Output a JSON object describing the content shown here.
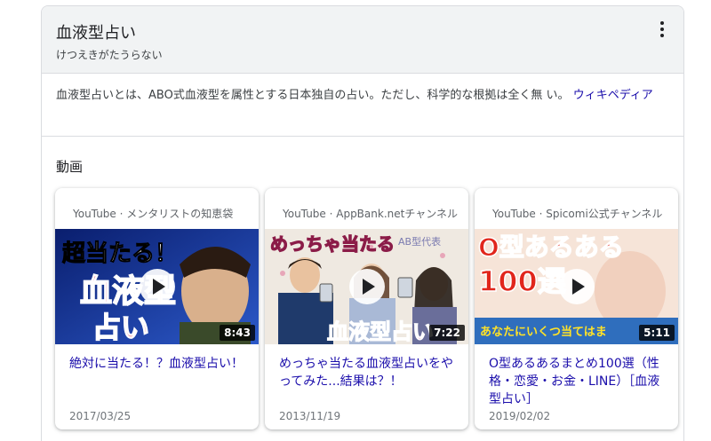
{
  "panel": {
    "title": "血液型占い",
    "subtitle": "けつえきがたうらない",
    "description": "血液型占いとは、ABO式血液型を属性とする日本独自の占い。ただし、科学的な根拠は全く無 い。",
    "description_link": "ウィキペディア",
    "menu_icon": "more-vert-icon"
  },
  "videos": {
    "section_title": "動画",
    "items": [
      {
        "source": "YouTube · メンタリストの知恵袋",
        "thumb_text_1": "超当たる！",
        "thumb_text_2": "血液型",
        "thumb_text_3": "占い",
        "duration": "8:43",
        "title": "絶対に当たる！？血液型占い！",
        "date": "2017/03/25"
      },
      {
        "source": "YouTube · AppBank.netチャンネル",
        "thumb_text_1": "めっちゃ当たる",
        "thumb_text_2": "AB型代表",
        "thumb_text_3": "血液型占い",
        "duration": "7:22",
        "title": "めっちゃ当たる血液型占いをやってみた...結果は？！",
        "date": "2013/11/19"
      },
      {
        "source": "YouTube · Spicomi公式チャンネル",
        "thumb_text_1": "O型あるある",
        "thumb_text_2": "100選",
        "thumb_text_3": "あなたにいくつ当てはま",
        "duration": "5:11",
        "title": "O型あるあるまとめ100選（性格・恋愛・お金・LINE）［血液型占い］",
        "date": "2019/02/02"
      }
    ]
  },
  "colors": {
    "link": "#1a0dab",
    "header_bg": "#f1f3f4",
    "border": "#dadce0"
  }
}
